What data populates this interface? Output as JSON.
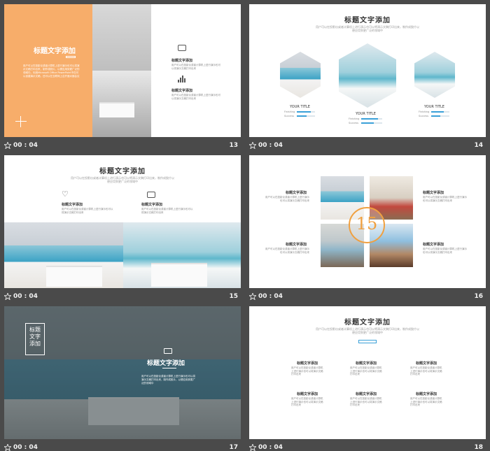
{
  "common": {
    "time": "00 : 04"
  },
  "slides": [
    {
      "num": "13",
      "title": "标题文字添加",
      "body": "用户可以在投影仪或者计算机上进行演示也可以将演示文稿打印出来，制作成胶片，以便应用到更广泛的领域中。利用Microsoft Office PowerPoint不仅可以创建演示文稿，还可以在互联网上召开面对面会议",
      "items": [
        {
          "heading": "标题文字添加",
          "text": "用户可以在投影仪或者计算机上进行演示也可以将演示文稿打印出来"
        },
        {
          "heading": "标题文字添加",
          "text": "用户可以在投影仪或者计算机上进行演示也可以将演示文稿打印出来"
        }
      ]
    },
    {
      "num": "14",
      "title": "标题文字添加",
      "sub": "用户可以在投影仪或者计算机上进行演示也可以将演示文稿打印出来，制作成胶片以便应用到更广泛的领域中",
      "hexes": [
        {
          "label": "YOUR TITLE",
          "rows": [
            {
              "name": "Finishing",
              "value": 0.75
            },
            {
              "name": "Success",
              "value": 0.55
            }
          ]
        },
        {
          "label": "YOUR TITLE",
          "rows": [
            {
              "name": "Finishing",
              "value": 0.8
            },
            {
              "name": "Success",
              "value": 0.6
            }
          ]
        },
        {
          "label": "YOUR TITLE",
          "rows": [
            {
              "name": "Finishing",
              "value": 0.7
            },
            {
              "name": "Success",
              "value": 0.5
            }
          ]
        }
      ]
    },
    {
      "num": "15",
      "title": "标题文字添加",
      "sub": "用户可以在投影仪或者计算机上进行演示也可以将演示文稿打印出来，制作成胶片以便应用到更广泛的领域中",
      "items": [
        {
          "heading": "标题文字添加",
          "text": "用户可以在投影仪或者计算机上进行演示也可以将演示文稿打印出来"
        },
        {
          "heading": "标题文字添加",
          "text": "用户可以在投影仪或者计算机上进行演示也可以将演示文稿打印出来"
        }
      ]
    },
    {
      "num": "16",
      "center_text": "15",
      "items": [
        {
          "heading": "标题文字添加",
          "text": "用户可以在投影仪或者计算机上进行演示也可以将演示文稿打印出来"
        },
        {
          "heading": "标题文字添加",
          "text": "用户可以在投影仪或者计算机上进行演示也可以将演示文稿打印出来"
        },
        {
          "heading": "标题文字添加",
          "text": "用户可以在投影仪或者计算机上进行演示也可以将演示文稿打印出来"
        },
        {
          "heading": "标题文字添加",
          "text": "用户可以在投影仪或者计算机上进行演示也可以将演示文稿打印出来"
        }
      ]
    },
    {
      "num": "17",
      "badge": [
        "标题",
        "文字",
        "添加"
      ],
      "title": "标题文字添加",
      "body": "用户可以在投影仪或者计算机上进行演示也可以将演示文稿打印出来，制作成胶片，以便应用到更广泛的领域中"
    },
    {
      "num": "18",
      "title": "标题文字添加",
      "sub": "用户可以在投影仪或者计算机上进行演示也可以将演示文稿打印出来，制作成胶片以便应用到更广泛的领域中",
      "items": [
        {
          "heading": "标题文字添加",
          "text": "用户可以在投影仪或者计算机上进行演示也可以将演示文稿打印出来"
        },
        {
          "heading": "标题文字添加",
          "text": "用户可以在投影仪或者计算机上进行演示也可以将演示文稿打印出来"
        },
        {
          "heading": "标题文字添加",
          "text": "用户可以在投影仪或者计算机上进行演示也可以将演示文稿打印出来"
        },
        {
          "heading": "标题文字添加",
          "text": "用户可以在投影仪或者计算机上进行演示也可以将演示文稿打印出来"
        },
        {
          "heading": "标题文字添加",
          "text": "用户可以在投影仪或者计算机上进行演示也可以将演示文稿打印出来"
        },
        {
          "heading": "标题文字添加",
          "text": "用户可以在投影仪或者计算机上进行演示也可以将演示文稿打印出来"
        }
      ]
    }
  ],
  "colors": {
    "accent_orange": "#f7ad6a",
    "accent_blue": "#3aa0d8",
    "background": "#4a4a4a"
  }
}
